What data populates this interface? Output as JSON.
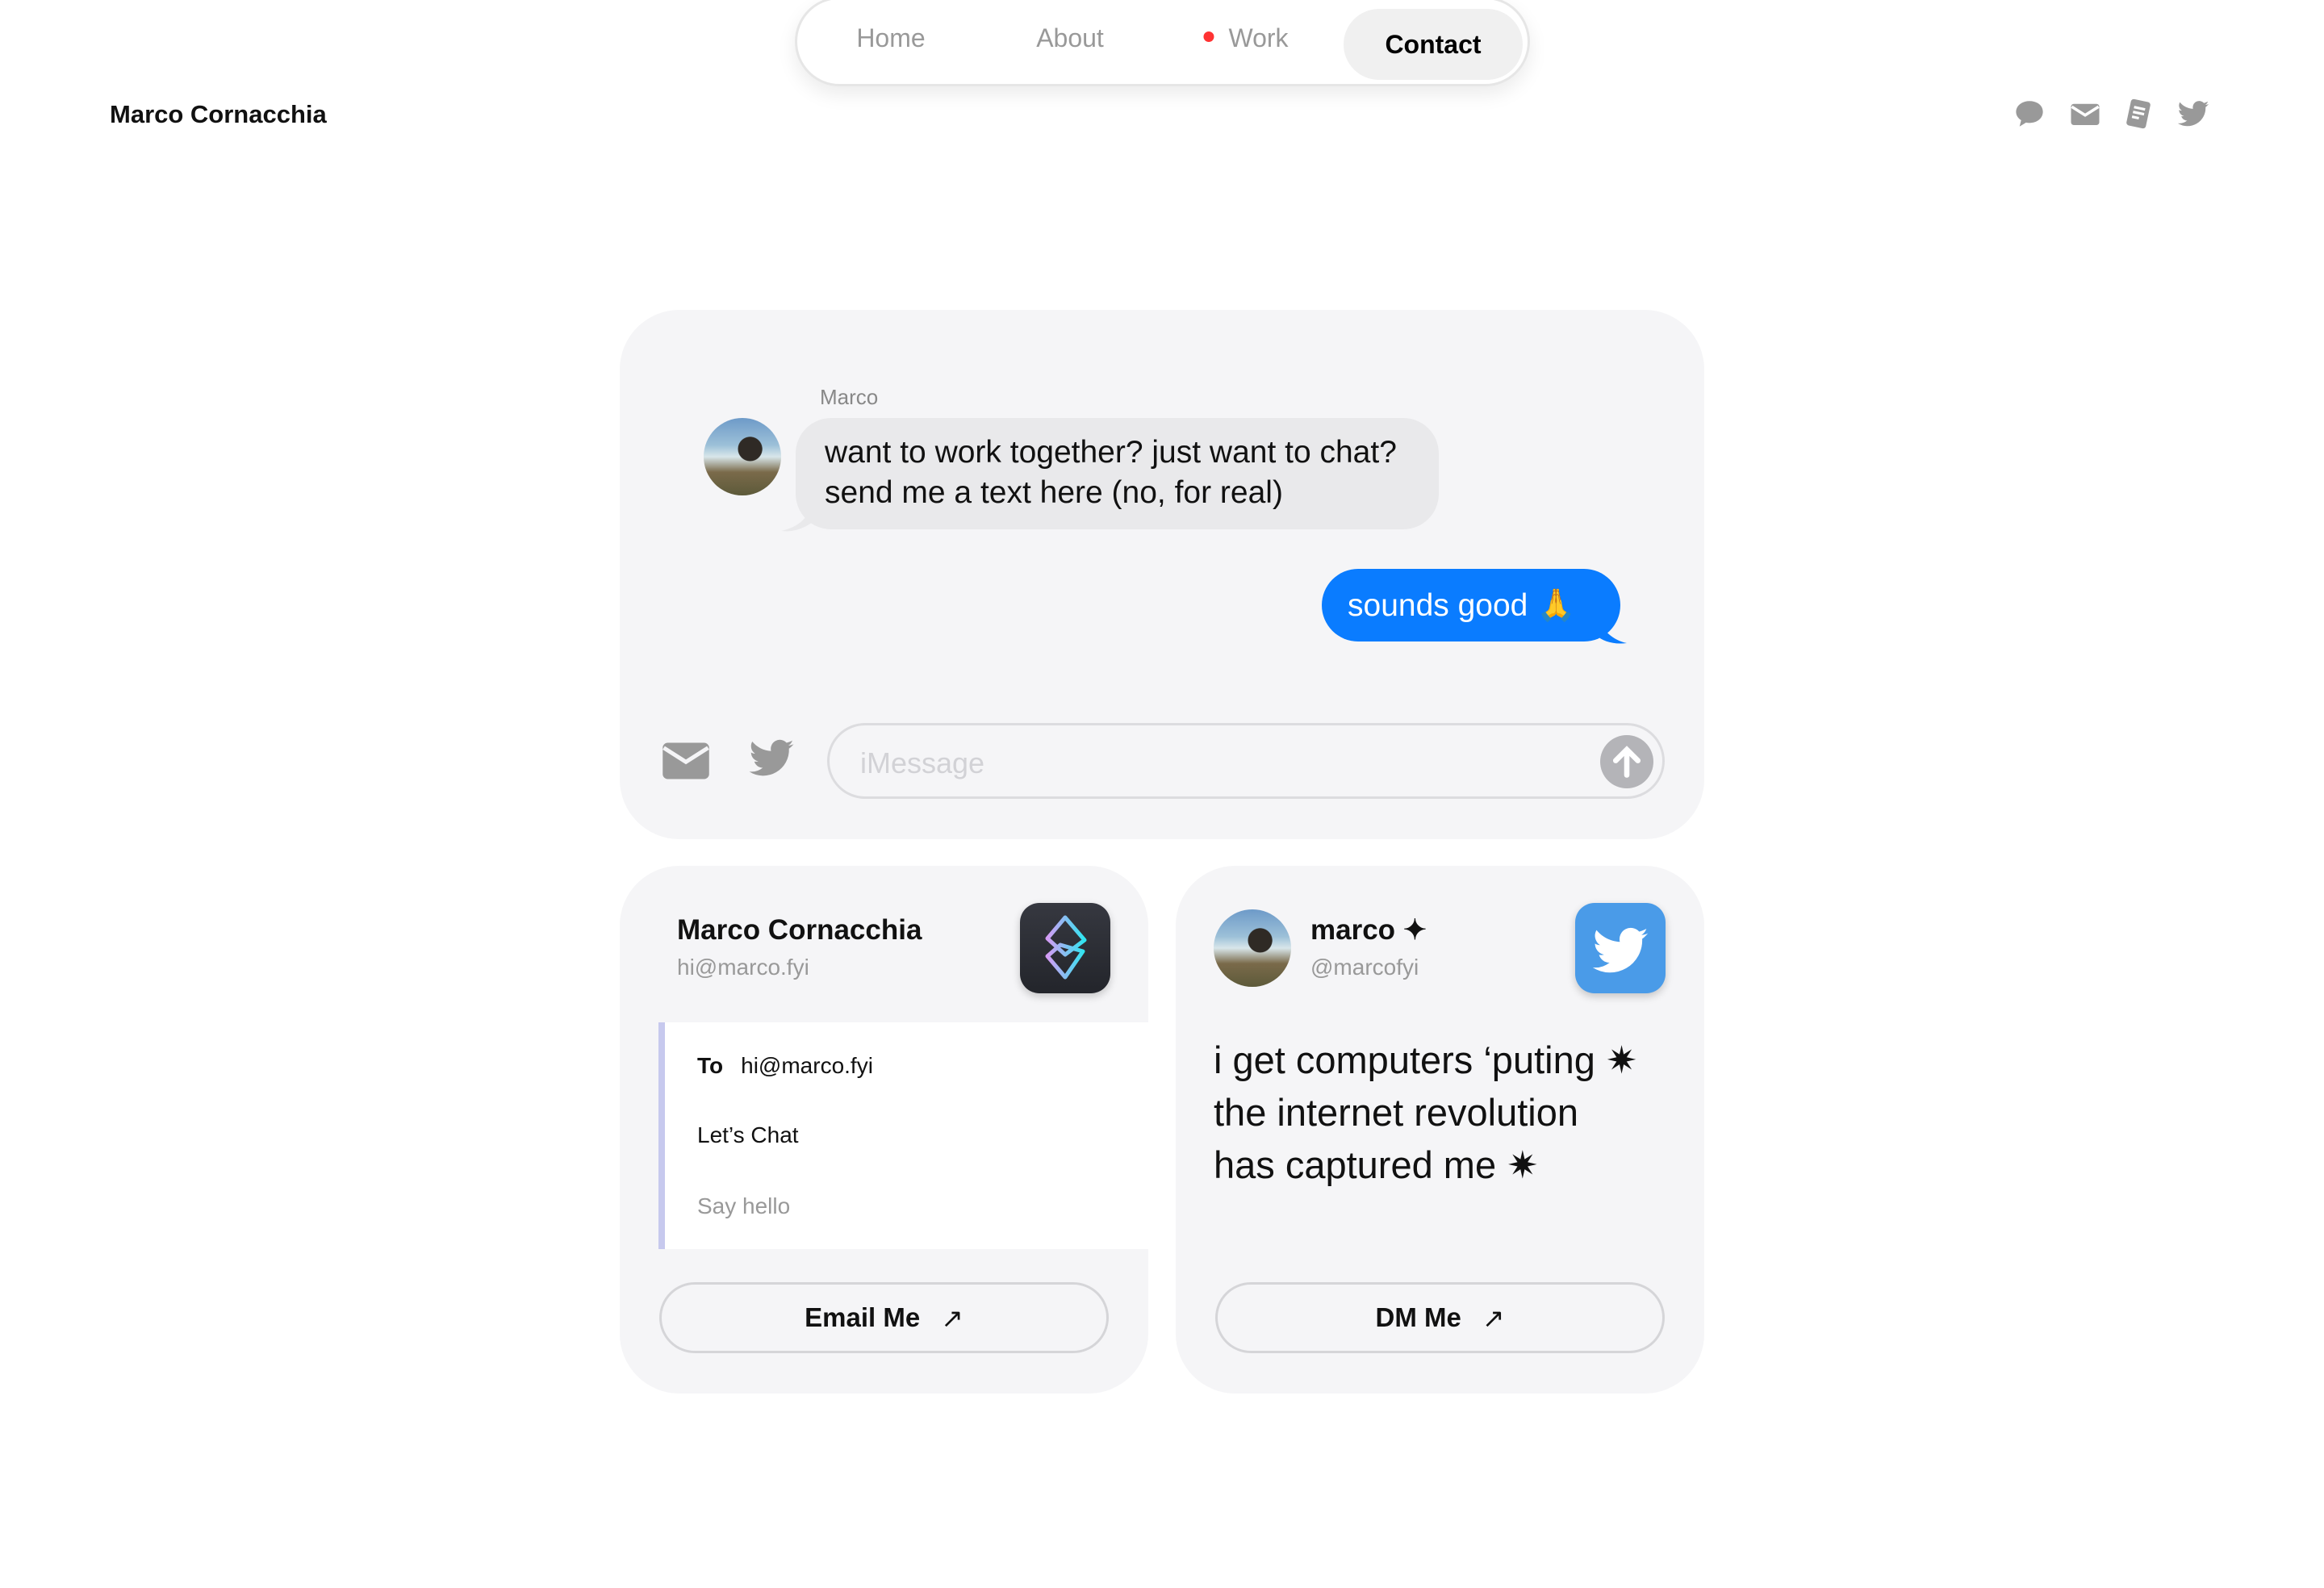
{
  "nav": {
    "items": [
      {
        "label": "Home"
      },
      {
        "label": "About"
      },
      {
        "label": "Work"
      },
      {
        "label": "Contact"
      }
    ],
    "active": "Contact",
    "work_indicator_color": "#ff3b30"
  },
  "header": {
    "name": "Marco Cornacchia",
    "icons": [
      "message-icon",
      "mail-icon",
      "document-icon",
      "twitter-icon"
    ]
  },
  "chat": {
    "sender": "Marco",
    "incoming": "want to work together? just want to chat? send me a text here (no, for real)",
    "outgoing": "sounds good 🙏",
    "input_placeholder": "iMessage",
    "accent": "#0a7cff"
  },
  "email_card": {
    "name": "Marco Cornacchia",
    "email": "hi@marco.fyi",
    "to_label": "To",
    "to_value": "hi@marco.fyi",
    "subject": "Let’s Chat",
    "body_placeholder": "Say hello",
    "button": "Email Me"
  },
  "twitter_card": {
    "name": "marco ✦",
    "handle": "@marcofyi",
    "tweet_lines": [
      "i get computers ‘puting ✷",
      "the internet revolution",
      "has captured me ✷"
    ],
    "button": "DM Me",
    "brand": "#4a9be8"
  }
}
